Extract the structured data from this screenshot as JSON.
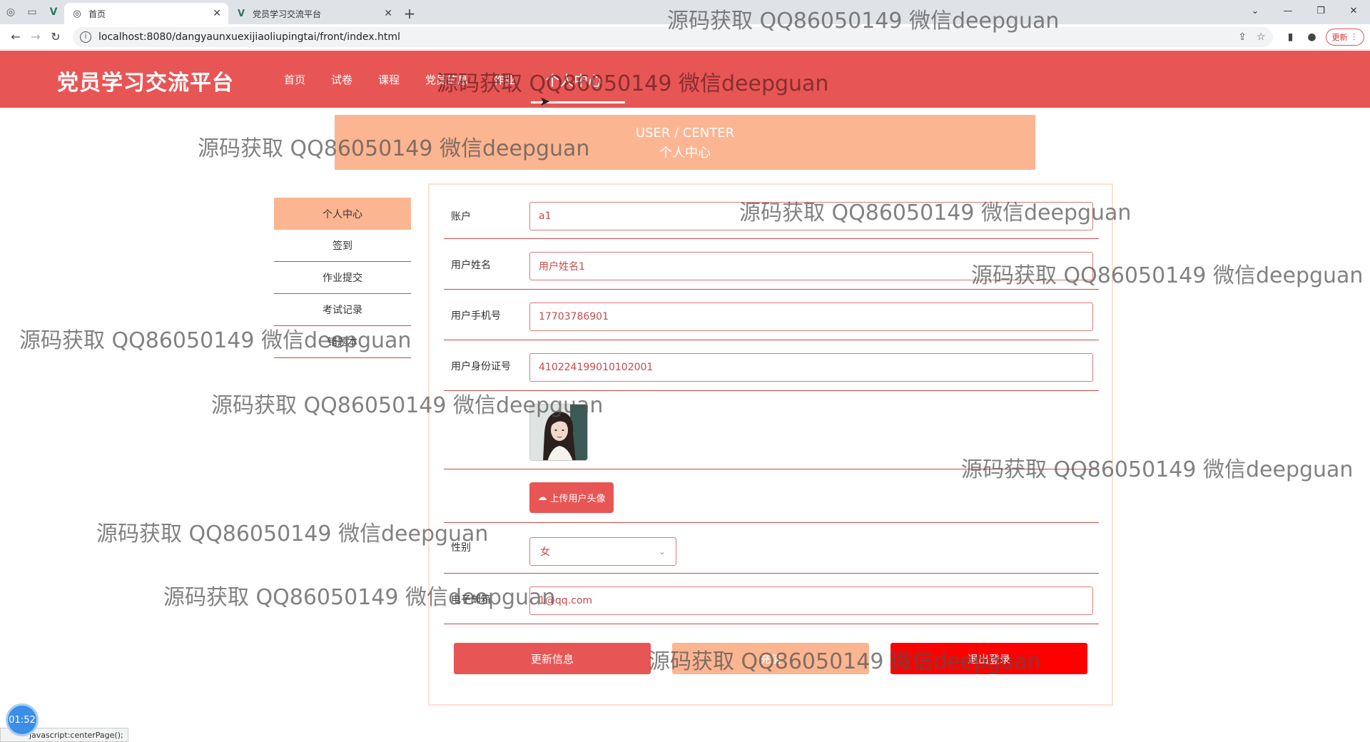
{
  "browser": {
    "tabs": [
      {
        "title": "首页",
        "active": true
      },
      {
        "title": "党员学习交流平台",
        "active": false
      }
    ],
    "url": "localhost:8080/dangyaunxuexijiaoliupingtai/front/index.html",
    "update_label": "更新",
    "status_text": "javascript:centerPage();"
  },
  "header": {
    "brand": "党员学习交流平台",
    "nav": [
      {
        "label": "首页"
      },
      {
        "label": "试卷"
      },
      {
        "label": "课程"
      },
      {
        "label": "党员信息"
      },
      {
        "label": "作业"
      },
      {
        "label": "个人中心",
        "active": true
      }
    ]
  },
  "banner": {
    "en": "USER / CENTER",
    "cn": "个人中心"
  },
  "sidemenu": {
    "items": [
      {
        "label": "个人中心",
        "active": true
      },
      {
        "label": "签到"
      },
      {
        "label": "作业提交"
      },
      {
        "label": "考试记录"
      },
      {
        "label": "错题本"
      }
    ]
  },
  "form": {
    "account": {
      "label": "账户",
      "value": "a1"
    },
    "name": {
      "label": "用户姓名",
      "value": "用户姓名1"
    },
    "phone": {
      "label": "用户手机号",
      "value": "17703786901"
    },
    "idcard": {
      "label": "用户身份证号",
      "value": "410224199010102001"
    },
    "upload_label": "上传用户头像",
    "gender": {
      "label": "性别",
      "value": "女"
    },
    "email": {
      "label": "电子邮箱",
      "value": "1@qq.com"
    },
    "buttons": {
      "update": "更新信息",
      "recharge": "充值",
      "logout": "退出登录"
    }
  },
  "timer": "01:52",
  "watermark": "源码获取 QQ86050149 微信deepguan",
  "colors": {
    "primary": "#e85555",
    "accent": "#fcb591",
    "danger": "#ff0000"
  }
}
